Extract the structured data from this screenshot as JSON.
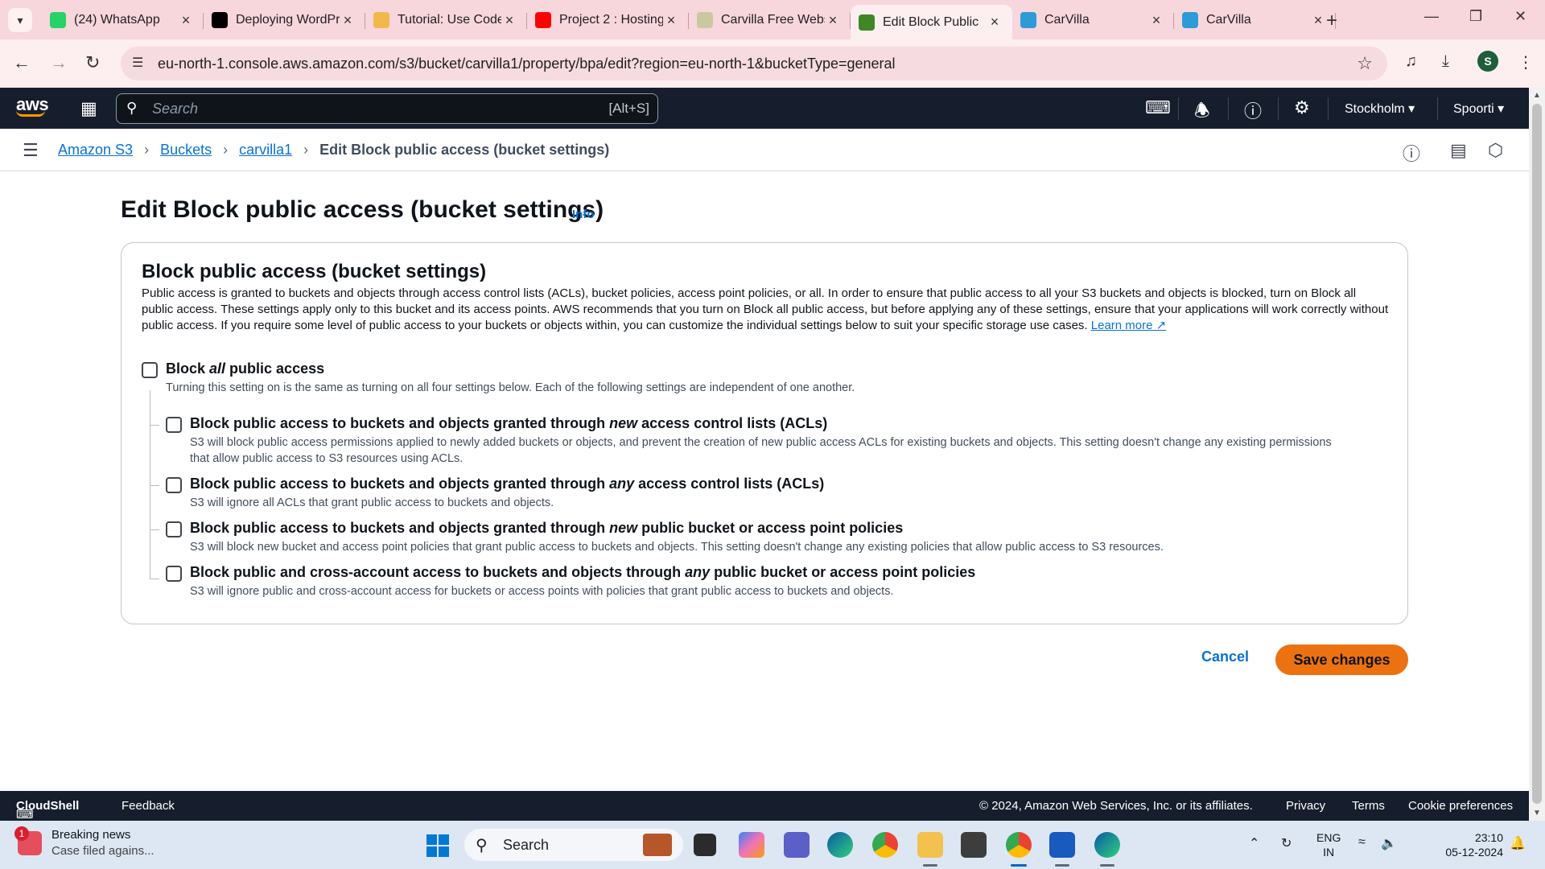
{
  "browser": {
    "tabs": [
      {
        "label": "(24) WhatsApp",
        "icon": "whatsapp-icon",
        "color": "#25d366"
      },
      {
        "label": "Deploying WordPress",
        "icon": "medium-icon",
        "color": "#000000"
      },
      {
        "label": "Tutorial: Use Code",
        "icon": "docs-icon",
        "color": "#f2b84b"
      },
      {
        "label": "Project 2 : Hosting",
        "icon": "youtube-icon",
        "color": "#ff0000"
      },
      {
        "label": "Carvilla Free Website",
        "icon": "template-icon",
        "color": "#c9c9a0"
      },
      {
        "label": "Edit Block Public",
        "icon": "aws-s3-icon",
        "color": "#3f8624"
      },
      {
        "label": "CarVilla",
        "icon": "carvilla-icon",
        "color": "#2e9bd6"
      },
      {
        "label": "CarVilla",
        "icon": "carvilla-icon",
        "color": "#2e9bd6"
      }
    ],
    "url": "eu-north-1.console.aws.amazon.com/s3/bucket/carvilla1/property/bpa/edit?region=eu-north-1&bucketType=general",
    "profile_initial": "S"
  },
  "aws": {
    "logo": "aws",
    "search_placeholder": "Search",
    "search_shortcut": "[Alt+S]",
    "region": "Stockholm",
    "account": "Spoorti"
  },
  "breadcrumb": {
    "items": [
      "Amazon S3",
      "Buckets",
      "carvilla1"
    ],
    "current": "Edit Block public access (bucket settings)"
  },
  "page": {
    "title": "Edit Block public access (bucket settings)",
    "info": "Info"
  },
  "section": {
    "title": "Block public access (bucket settings)",
    "description": "Public access is granted to buckets and objects through access control lists (ACLs), bucket policies, access point policies, or all. In order to ensure that public access to all your S3 buckets and objects is blocked, turn on Block all public access. These settings apply only to this bucket and its access points. AWS recommends that you turn on Block all public access, but before applying any of these settings, ensure that your applications will work correctly without public access. If you require some level of public access to your buckets or objects within, you can customize the individual settings below to suit your specific storage use cases.",
    "learn_more": "Learn more",
    "block_all": {
      "label_pre": "Block ",
      "label_em": "all",
      "label_post": " public access",
      "checked": false,
      "description": "Turning this setting on is the same as turning on all four settings below. Each of the following settings are independent of one another."
    },
    "options": [
      {
        "label_pre": "Block public access to buckets and objects granted through ",
        "label_em": "new",
        "label_post": " access control lists (ACLs)",
        "checked": false,
        "description": "S3 will block public access permissions applied to newly added buckets or objects, and prevent the creation of new public access ACLs for existing buckets and objects. This setting doesn't change any existing permissions that allow public access to S3 resources using ACLs."
      },
      {
        "label_pre": "Block public access to buckets and objects granted through ",
        "label_em": "any",
        "label_post": " access control lists (ACLs)",
        "checked": false,
        "description": "S3 will ignore all ACLs that grant public access to buckets and objects."
      },
      {
        "label_pre": "Block public access to buckets and objects granted through ",
        "label_em": "new",
        "label_post": " public bucket or access point policies",
        "checked": false,
        "description": "S3 will block new bucket and access point policies that grant public access to buckets and objects. This setting doesn't change any existing policies that allow public access to S3 resources."
      },
      {
        "label_pre": "Block public and cross-account access to buckets and objects through ",
        "label_em": "any",
        "label_post": " public bucket or access point policies",
        "checked": false,
        "description": "S3 will ignore public and cross-account access for buckets or access points with policies that grant public access to buckets and objects."
      }
    ]
  },
  "actions": {
    "cancel": "Cancel",
    "save": "Save changes"
  },
  "footer": {
    "cloudshell": "CloudShell",
    "feedback": "Feedback",
    "copyright": "© 2024, Amazon Web Services, Inc. or its affiliates.",
    "privacy": "Privacy",
    "terms": "Terms",
    "cookies": "Cookie preferences"
  },
  "taskbar": {
    "news_title": "Breaking news",
    "news_sub": "Case filed agains...",
    "news_badge": "1",
    "search": "Search",
    "lang_1": "ENG",
    "lang_2": "IN",
    "time": "23:10",
    "date": "05-12-2024"
  },
  "colors": {
    "aws_nav": "#161e2d",
    "link": "#0972d3",
    "primary_button": "#ec7211",
    "tab_strip": "#f7d6dc"
  }
}
